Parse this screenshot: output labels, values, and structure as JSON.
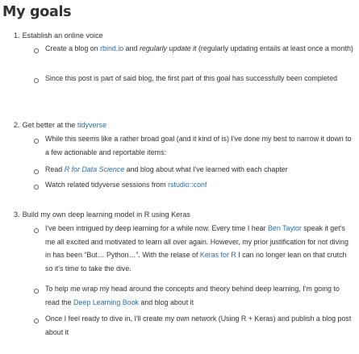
{
  "title": "My goals",
  "goals": [
    {
      "number": "1.",
      "label": "Establish an online voice",
      "bullets": [
        {
          "b1_pre": "Create a blog on ",
          "b1_link": "rbind.io",
          "b1_mid": " and ",
          "b1_em": "regularly update it",
          "b1_post": " (regularly updating entails at least once a month)"
        },
        {
          "text": "Since this post is part of said blog, the first part of this goal has successfully been completed"
        }
      ]
    },
    {
      "number": "2.",
      "label_pre": "Get better at the ",
      "label_link": "tidyverse",
      "bullets": [
        {
          "text": "While this seems like a rather broad goal (and it kind of is) I've done my best to narrow it down to a few actionable and reportable items:"
        },
        {
          "pre": "Read ",
          "link": "R for Data Science",
          "post": " and blog about what I've learned with each chapter"
        },
        {
          "pre": "Watch related tidyverse sessions from ",
          "link": "rstudio::conf"
        }
      ]
    },
    {
      "number": "3.",
      "label": "Build my own deep learning model in R using Keras",
      "bullets": [
        {
          "pre": "I've been intrigued by deep learning for a while now. Every time I hear ",
          "link1": "Ben Taylor",
          "mid": " speak it get's me all excited and motivated to learn all over again. However, my prior justification for not diving in has been “But… Python…”. With the relase of ",
          "link2": "Keras for R",
          "post": " I can no longer lean on that crutch so it's time to take the dive."
        },
        {
          "pre": "To help me wrap my head around the concepts and theory behind deep learning, I'm going to read the ",
          "link": "Deep Learning Book",
          "post": " and blog about it"
        },
        {
          "text": "Once I feel ready to dive in, I'll create my own network (Using R + Keras) and publish a blog post about it"
        }
      ]
    }
  ],
  "colors": {
    "text": "#333333",
    "link": "#2f6fa8",
    "bullet": "#6b6b6b"
  }
}
